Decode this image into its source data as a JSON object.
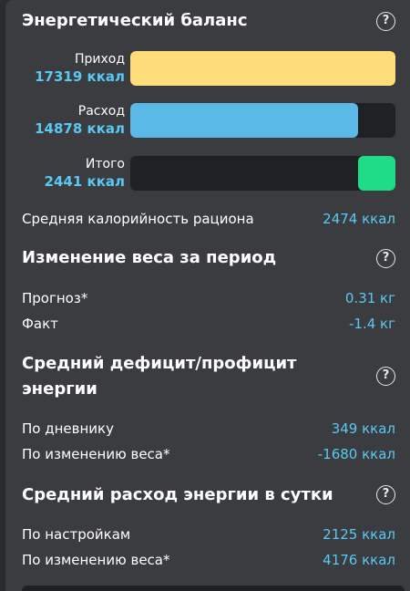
{
  "energy_balance": {
    "title": "Энергетический баланс",
    "help_icon": "question-circle-icon",
    "bars": [
      {
        "name": "Приход",
        "value": "17319 ккал",
        "fraction": 1.0,
        "color": "#fedd7a"
      },
      {
        "name": "Расход",
        "value": "14878 ккал",
        "fraction": 0.859,
        "color": "#5bb9e8"
      },
      {
        "name": "Итого",
        "value": "2441 ккал",
        "fraction": 0.141,
        "color": "#1fdc86"
      }
    ],
    "avg_calorie_label": "Средняя калорийность рациона",
    "avg_calorie_value": "2474 ккал"
  },
  "weight_change": {
    "title": "Изменение веса за период",
    "help_icon": "question-circle-icon",
    "forecast_label": "Прогноз*",
    "forecast_value": "0.31 кг",
    "fact_label": "Факт",
    "fact_value": "-1.4 кг"
  },
  "deficit": {
    "title_line1": "Средний дефицит/профицит",
    "title_line2": "энергии",
    "help_icon": "question-circle-icon",
    "diary_label": "По дневнику",
    "diary_value": "349 ккал",
    "weight_label": "По изменению веса*",
    "weight_value": "-1680 ккал"
  },
  "expenditure": {
    "title": "Средний расход энергии в сутки",
    "help_icon": "question-circle-icon",
    "settings_label": "По настройкам",
    "settings_value": "2125 ккал",
    "weight_label": "По изменению веса*",
    "weight_value": "4176 ккал"
  }
}
